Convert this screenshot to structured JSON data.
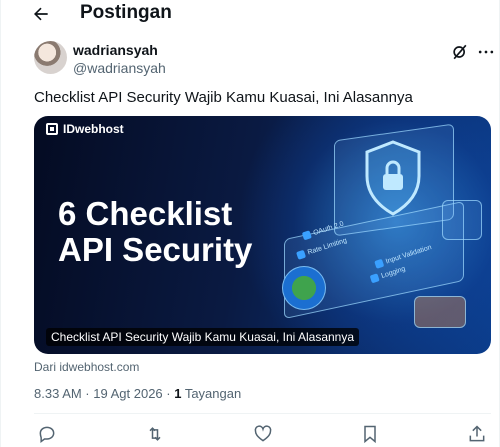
{
  "header": {
    "back_icon": "arrow-left-icon",
    "title": "Postingan"
  },
  "author": {
    "display_name": "wadriansyah",
    "handle": "@wadriansyah",
    "avatar": "avatar"
  },
  "post": {
    "text": "Checklist API Security Wajib Kamu Kuasai, Ini Alasannya",
    "card": {
      "brand": "IDwebhost",
      "headline_line1": "6 Checklist",
      "headline_line2": "API Security",
      "items": [
        "OAuth 2.0",
        "Rate Limiting",
        "Input Validation",
        "Logging"
      ],
      "caption": "Checklist API Security Wajib Kamu Kuasai, Ini Alasannya"
    },
    "source": "Dari idwebhost.com",
    "timestamp": "8.33 AM · 19 Agt 2026 · ",
    "views_count": "1",
    "views_label": " Tayangan"
  },
  "actions": [
    "reply-icon",
    "repost-icon",
    "like-icon",
    "bookmark-icon",
    "share-icon"
  ],
  "colors": {
    "text": "#0f1419",
    "muted": "#536471",
    "border": "#eff3f4"
  }
}
